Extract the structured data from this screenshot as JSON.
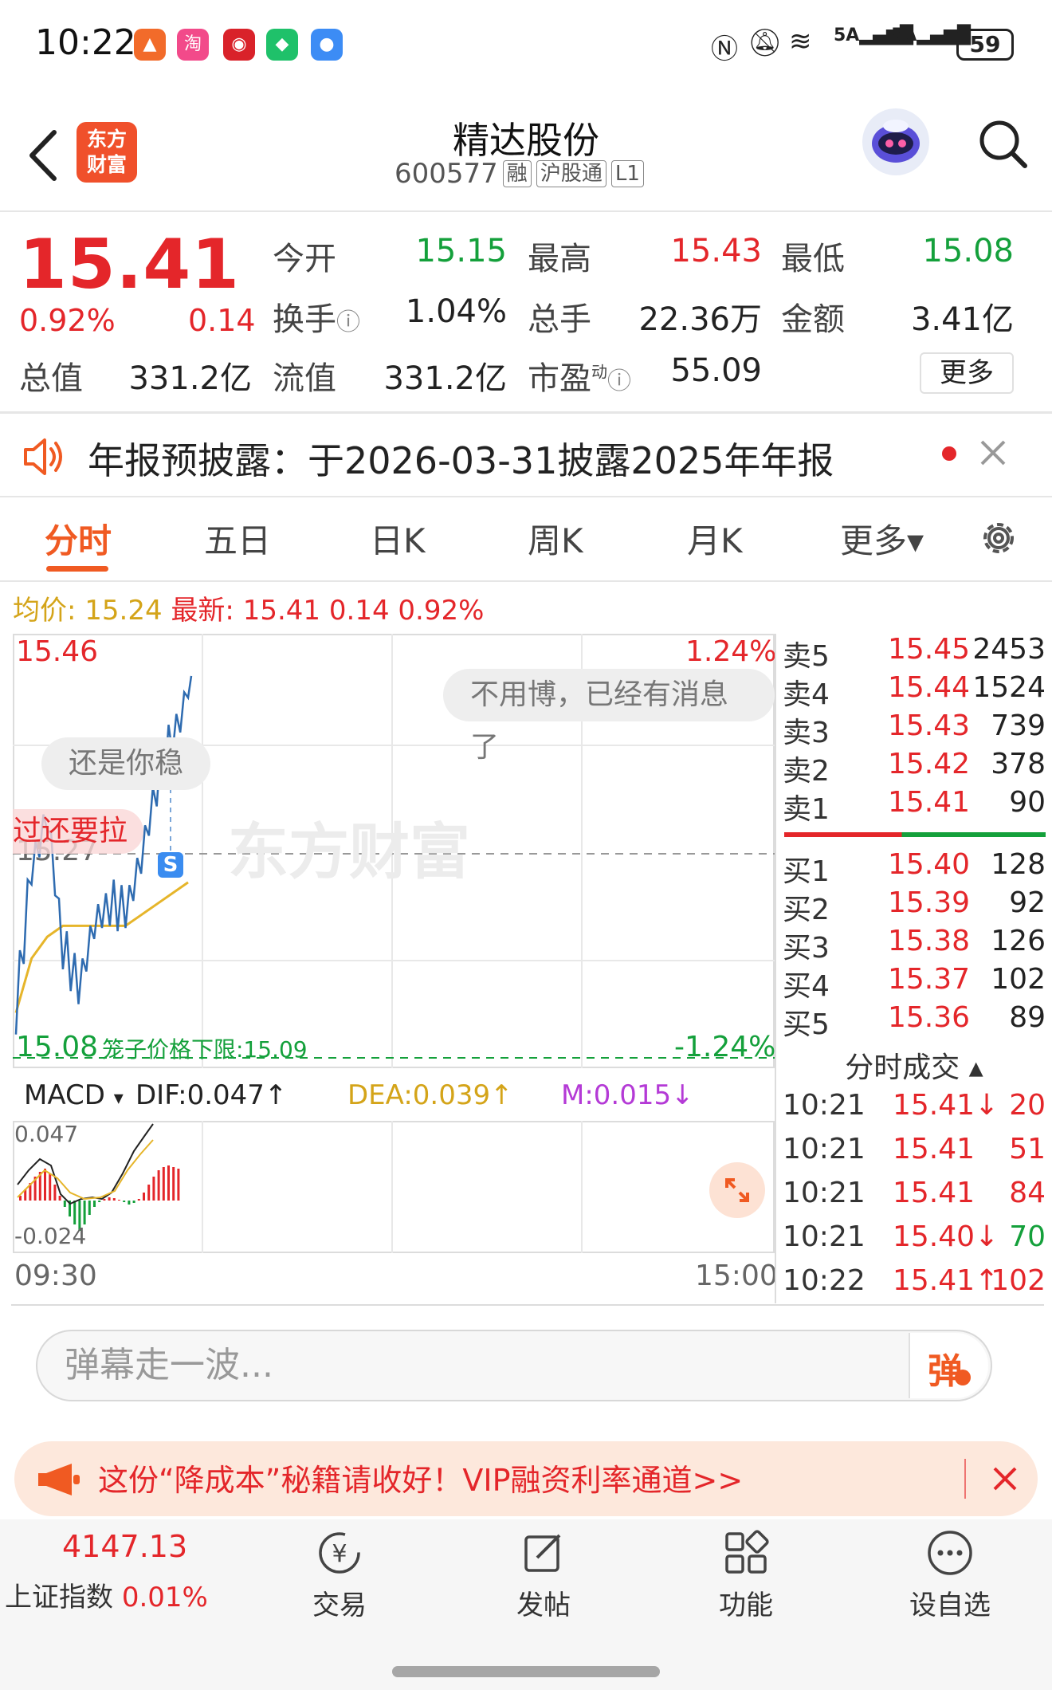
{
  "status_bar": {
    "time": "10:22",
    "battery": "59"
  },
  "header": {
    "logo_line1": "东方",
    "logo_line2": "财富",
    "stock_name": "精达股份",
    "stock_code": "600577",
    "tags": [
      "融",
      "沪股通",
      "L1"
    ]
  },
  "quote": {
    "last_price": "15.41",
    "change_pct": "0.92%",
    "change_amt": "0.14",
    "open_label": "今开",
    "open_value": "15.15",
    "high_label": "最高",
    "high_value": "15.43",
    "low_label": "最低",
    "low_value": "15.08",
    "turnover_label": "换手",
    "turnover_value": "1.04%",
    "volume_label": "总手",
    "volume_value": "22.36万",
    "amount_label": "金额",
    "amount_value": "3.41亿",
    "mcap_label": "总值",
    "mcap_value": "331.2亿",
    "float_label": "流值",
    "float_value": "331.2亿",
    "pe_label": "市盈",
    "pe_super": "动",
    "pe_value": "55.09",
    "more_label": "更多"
  },
  "notice": {
    "text": "年报预披露：于2026-03-31披露2025年年报"
  },
  "tabs": [
    {
      "label": "分时",
      "active": true
    },
    {
      "label": "五日"
    },
    {
      "label": "日K"
    },
    {
      "label": "周K"
    },
    {
      "label": "月K"
    },
    {
      "label": "更多▾"
    }
  ],
  "avg_info": {
    "avg_label": "均价:",
    "avg_value": "15.24",
    "latest_label": "最新:",
    "latest_value": "15.41",
    "latest_chg": "0.14",
    "latest_pct": "0.92%"
  },
  "chart": {
    "y_max": "15.46",
    "y_mid": "15.27",
    "y_min": "15.08",
    "pct_max": "1.24%",
    "pct_min": "-1.24%",
    "limit_label": "笼子价格下限:15.09",
    "watermark": "东方财富",
    "bubbles": [
      "不用博，已经有消息了",
      "还是你稳",
      "过还要拉"
    ],
    "s_marker": "S",
    "macd_label": "MACD",
    "dif": "DIF:0.047",
    "dea": "DEA:0.039",
    "m": "M:0.015",
    "macd_max": "0.047",
    "macd_min": "-0.024",
    "time_start": "09:30",
    "time_end": "15:00",
    "colors": {
      "price_line": "#2e6bb0",
      "avg_line": "#e6b52a",
      "up": "#e4262a",
      "down": "#14a03b"
    }
  },
  "chart_data": {
    "type": "line",
    "xlabel": "",
    "ylabel": "",
    "ylim": [
      15.08,
      15.46
    ],
    "x": [
      "09:30",
      "09:35",
      "09:40",
      "09:45",
      "09:50",
      "09:55",
      "10:00",
      "10:05",
      "10:10",
      "10:15",
      "10:20",
      "10:22"
    ],
    "series": [
      {
        "values": [
          15.12,
          15.25,
          15.3,
          15.18,
          15.14,
          15.2,
          15.22,
          15.21,
          15.26,
          15.33,
          15.37,
          15.41
        ]
      },
      {
        "values": [
          15.12,
          15.17,
          15.19,
          15.2,
          15.2,
          15.2,
          15.2,
          15.2,
          15.21,
          15.22,
          15.23,
          15.24
        ]
      }
    ]
  },
  "order_book": {
    "asks": [
      {
        "label": "卖5",
        "price": "15.45",
        "vol": "2453"
      },
      {
        "label": "卖4",
        "price": "15.44",
        "vol": "1524"
      },
      {
        "label": "卖3",
        "price": "15.43",
        "vol": "739"
      },
      {
        "label": "卖2",
        "price": "15.42",
        "vol": "378"
      },
      {
        "label": "卖1",
        "price": "15.41",
        "vol": "90"
      }
    ],
    "bids": [
      {
        "label": "买1",
        "price": "15.40",
        "vol": "128"
      },
      {
        "label": "买2",
        "price": "15.39",
        "vol": "92"
      },
      {
        "label": "买3",
        "price": "15.38",
        "vol": "126"
      },
      {
        "label": "买4",
        "price": "15.37",
        "vol": "102"
      },
      {
        "label": "买5",
        "price": "15.36",
        "vol": "89"
      }
    ]
  },
  "trades": {
    "title": "分时成交 ▴",
    "rows": [
      {
        "time": "10:21",
        "price": "15.41↓",
        "vol": "20",
        "vol_color": "red"
      },
      {
        "time": "10:21",
        "price": "15.41",
        "vol": "51",
        "vol_color": "red"
      },
      {
        "time": "10:21",
        "price": "15.41",
        "vol": "84",
        "vol_color": "red"
      },
      {
        "time": "10:21",
        "price": "15.40↓",
        "vol": "70",
        "vol_color": "green"
      },
      {
        "time": "10:22",
        "price": "15.41↑",
        "vol": "102",
        "vol_color": "red"
      }
    ]
  },
  "danmu": {
    "placeholder": "弹幕走一波...",
    "button": "弹"
  },
  "promo": {
    "text": "这份“降成本”秘籍请收好！VIP融资利率通道>>"
  },
  "bottom_bar": {
    "index_value": "4147.13",
    "index_name": "上证指数",
    "index_change": "0.01%",
    "nav": [
      {
        "label": "交易"
      },
      {
        "label": "发帖"
      },
      {
        "label": "功能"
      },
      {
        "label": "设自选"
      }
    ]
  }
}
